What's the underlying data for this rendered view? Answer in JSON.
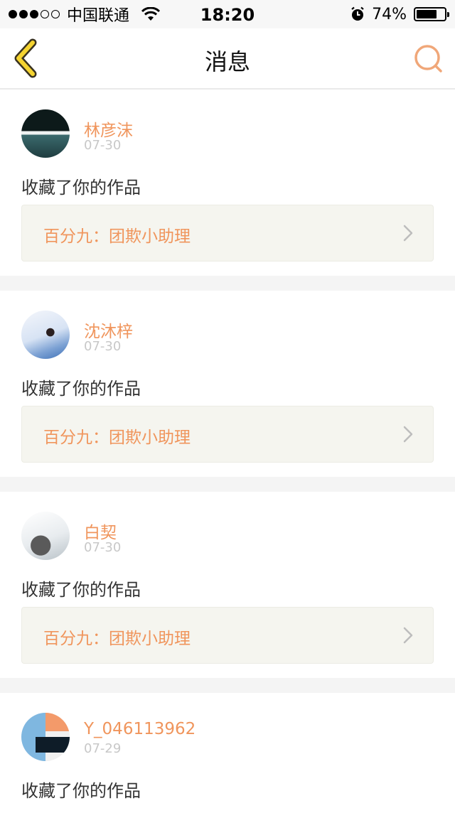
{
  "status_bar": {
    "carrier": "中国联通",
    "time": "18:20",
    "battery_percent": "74%",
    "battery_level": 0.74,
    "signal_bars_filled": 3,
    "signal_bars_total": 5
  },
  "nav": {
    "title": "消息",
    "back_icon": "chevron-left-icon",
    "search_icon": "search-icon",
    "accent_color": "#f0955c",
    "back_color": "#f5d431"
  },
  "messages": [
    {
      "user": "林彦沫",
      "date": "07-30",
      "action": "收藏了你的作品",
      "work_title": "百分九：团欺小助理"
    },
    {
      "user": "沈沐梓",
      "date": "07-30",
      "action": "收藏了你的作品",
      "work_title": "百分九：团欺小助理"
    },
    {
      "user": "白契",
      "date": "07-30",
      "action": "收藏了你的作品",
      "work_title": "百分九：团欺小助理"
    },
    {
      "user": "Y_046113962",
      "date": "07-29",
      "action": "收藏了你的作品"
    }
  ]
}
